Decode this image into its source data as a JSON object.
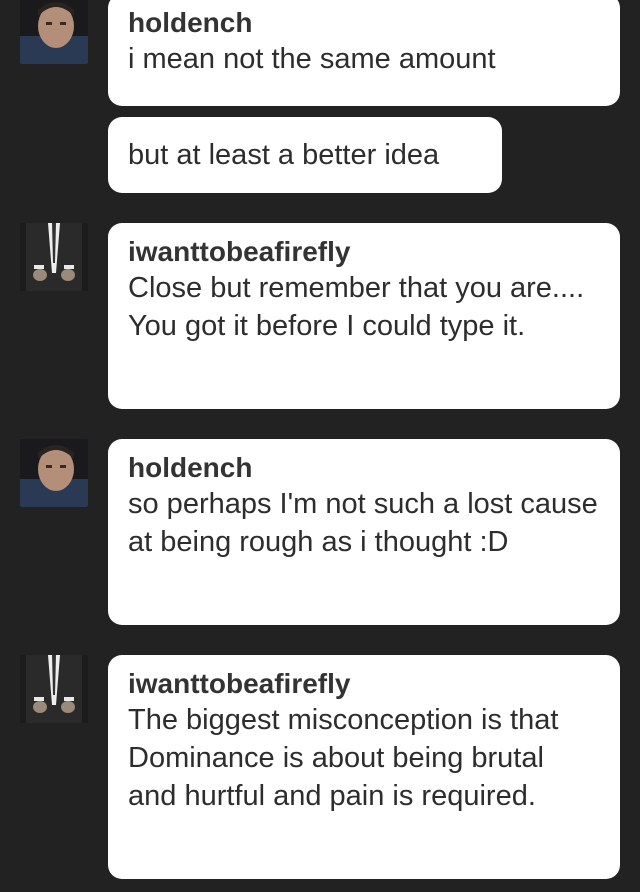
{
  "messages": [
    {
      "user": "holdench",
      "text": "i mean not the same amount"
    },
    {
      "text": "but at least a better idea"
    },
    {
      "user": "iwanttobeafirefly",
      "text": "Close but remember that you are.... You got it before I could type it."
    },
    {
      "user": "holdench",
      "text": "so perhaps I'm not such a lost cause at being rough as i thought :D"
    },
    {
      "user": "iwanttobeafirefly",
      "text": "The biggest misconception is that Dominance is about being brutal and hurtful and pain is required."
    }
  ]
}
